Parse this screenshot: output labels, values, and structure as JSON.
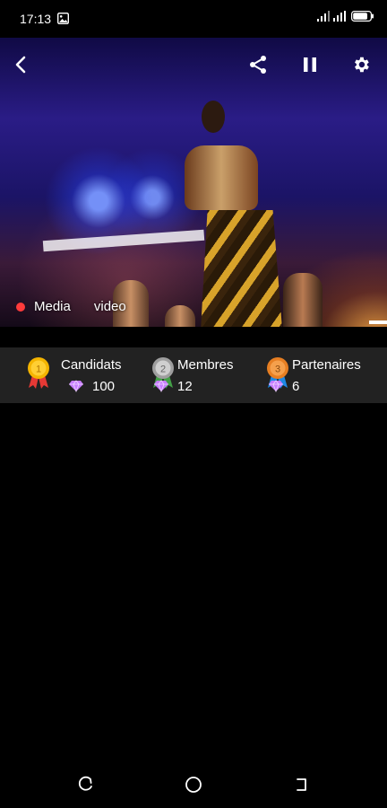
{
  "status": {
    "time": "17:13",
    "battery_level": 0.85
  },
  "player": {
    "media_label": "Media",
    "video_tag": "video",
    "controls": {
      "back_icon": "arrow-back-icon",
      "share_icon": "share-icon",
      "pause_icon": "pause-icon",
      "settings_icon": "gear-icon"
    }
  },
  "stats": [
    {
      "label": "Candidats",
      "value": "100",
      "medal_number": "1",
      "medal_color": "#f4b400",
      "ribbon_color": "#e53935"
    },
    {
      "label": "Membres",
      "value": "12",
      "medal_number": "2",
      "medal_color": "#9e9e9e",
      "ribbon_color": "#43a047"
    },
    {
      "label": "Partenaires",
      "value": "6",
      "medal_number": "3",
      "medal_color": "#e67e22",
      "ribbon_color": "#1e88e5"
    }
  ],
  "colors": {
    "gem": "#c77dff",
    "live_dot": "#ff3b3b",
    "stats_bg": "#222222"
  },
  "nav": {
    "recent_icon": "recent-apps-icon",
    "home_icon": "home-icon",
    "back_icon": "back-icon"
  }
}
